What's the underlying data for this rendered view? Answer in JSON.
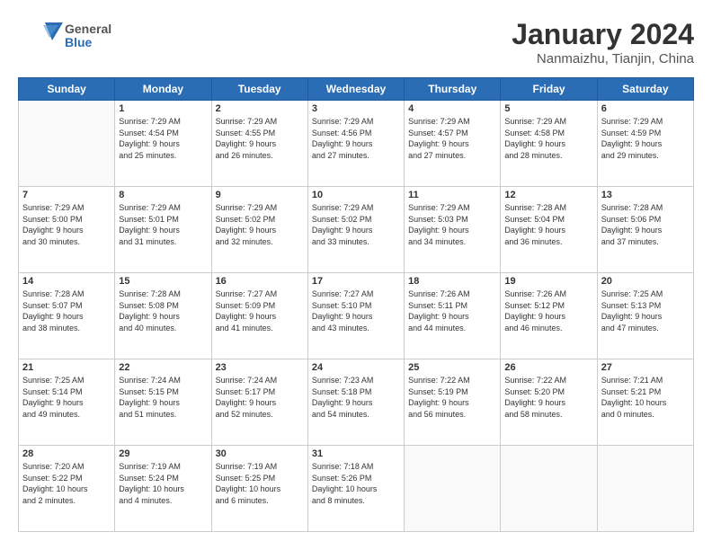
{
  "header": {
    "logo_general": "General",
    "logo_blue": "Blue",
    "title": "January 2024",
    "location": "Nanmaizhu, Tianjin, China"
  },
  "weekdays": [
    "Sunday",
    "Monday",
    "Tuesday",
    "Wednesday",
    "Thursday",
    "Friday",
    "Saturday"
  ],
  "weeks": [
    [
      {
        "day": "",
        "content": ""
      },
      {
        "day": "1",
        "content": "Sunrise: 7:29 AM\nSunset: 4:54 PM\nDaylight: 9 hours\nand 25 minutes."
      },
      {
        "day": "2",
        "content": "Sunrise: 7:29 AM\nSunset: 4:55 PM\nDaylight: 9 hours\nand 26 minutes."
      },
      {
        "day": "3",
        "content": "Sunrise: 7:29 AM\nSunset: 4:56 PM\nDaylight: 9 hours\nand 27 minutes."
      },
      {
        "day": "4",
        "content": "Sunrise: 7:29 AM\nSunset: 4:57 PM\nDaylight: 9 hours\nand 27 minutes."
      },
      {
        "day": "5",
        "content": "Sunrise: 7:29 AM\nSunset: 4:58 PM\nDaylight: 9 hours\nand 28 minutes."
      },
      {
        "day": "6",
        "content": "Sunrise: 7:29 AM\nSunset: 4:59 PM\nDaylight: 9 hours\nand 29 minutes."
      }
    ],
    [
      {
        "day": "7",
        "content": "Sunrise: 7:29 AM\nSunset: 5:00 PM\nDaylight: 9 hours\nand 30 minutes."
      },
      {
        "day": "8",
        "content": "Sunrise: 7:29 AM\nSunset: 5:01 PM\nDaylight: 9 hours\nand 31 minutes."
      },
      {
        "day": "9",
        "content": "Sunrise: 7:29 AM\nSunset: 5:02 PM\nDaylight: 9 hours\nand 32 minutes."
      },
      {
        "day": "10",
        "content": "Sunrise: 7:29 AM\nSunset: 5:02 PM\nDaylight: 9 hours\nand 33 minutes."
      },
      {
        "day": "11",
        "content": "Sunrise: 7:29 AM\nSunset: 5:03 PM\nDaylight: 9 hours\nand 34 minutes."
      },
      {
        "day": "12",
        "content": "Sunrise: 7:28 AM\nSunset: 5:04 PM\nDaylight: 9 hours\nand 36 minutes."
      },
      {
        "day": "13",
        "content": "Sunrise: 7:28 AM\nSunset: 5:06 PM\nDaylight: 9 hours\nand 37 minutes."
      }
    ],
    [
      {
        "day": "14",
        "content": "Sunrise: 7:28 AM\nSunset: 5:07 PM\nDaylight: 9 hours\nand 38 minutes."
      },
      {
        "day": "15",
        "content": "Sunrise: 7:28 AM\nSunset: 5:08 PM\nDaylight: 9 hours\nand 40 minutes."
      },
      {
        "day": "16",
        "content": "Sunrise: 7:27 AM\nSunset: 5:09 PM\nDaylight: 9 hours\nand 41 minutes."
      },
      {
        "day": "17",
        "content": "Sunrise: 7:27 AM\nSunset: 5:10 PM\nDaylight: 9 hours\nand 43 minutes."
      },
      {
        "day": "18",
        "content": "Sunrise: 7:26 AM\nSunset: 5:11 PM\nDaylight: 9 hours\nand 44 minutes."
      },
      {
        "day": "19",
        "content": "Sunrise: 7:26 AM\nSunset: 5:12 PM\nDaylight: 9 hours\nand 46 minutes."
      },
      {
        "day": "20",
        "content": "Sunrise: 7:25 AM\nSunset: 5:13 PM\nDaylight: 9 hours\nand 47 minutes."
      }
    ],
    [
      {
        "day": "21",
        "content": "Sunrise: 7:25 AM\nSunset: 5:14 PM\nDaylight: 9 hours\nand 49 minutes."
      },
      {
        "day": "22",
        "content": "Sunrise: 7:24 AM\nSunset: 5:15 PM\nDaylight: 9 hours\nand 51 minutes."
      },
      {
        "day": "23",
        "content": "Sunrise: 7:24 AM\nSunset: 5:17 PM\nDaylight: 9 hours\nand 52 minutes."
      },
      {
        "day": "24",
        "content": "Sunrise: 7:23 AM\nSunset: 5:18 PM\nDaylight: 9 hours\nand 54 minutes."
      },
      {
        "day": "25",
        "content": "Sunrise: 7:22 AM\nSunset: 5:19 PM\nDaylight: 9 hours\nand 56 minutes."
      },
      {
        "day": "26",
        "content": "Sunrise: 7:22 AM\nSunset: 5:20 PM\nDaylight: 9 hours\nand 58 minutes."
      },
      {
        "day": "27",
        "content": "Sunrise: 7:21 AM\nSunset: 5:21 PM\nDaylight: 10 hours\nand 0 minutes."
      }
    ],
    [
      {
        "day": "28",
        "content": "Sunrise: 7:20 AM\nSunset: 5:22 PM\nDaylight: 10 hours\nand 2 minutes."
      },
      {
        "day": "29",
        "content": "Sunrise: 7:19 AM\nSunset: 5:24 PM\nDaylight: 10 hours\nand 4 minutes."
      },
      {
        "day": "30",
        "content": "Sunrise: 7:19 AM\nSunset: 5:25 PM\nDaylight: 10 hours\nand 6 minutes."
      },
      {
        "day": "31",
        "content": "Sunrise: 7:18 AM\nSunset: 5:26 PM\nDaylight: 10 hours\nand 8 minutes."
      },
      {
        "day": "",
        "content": ""
      },
      {
        "day": "",
        "content": ""
      },
      {
        "day": "",
        "content": ""
      }
    ]
  ]
}
